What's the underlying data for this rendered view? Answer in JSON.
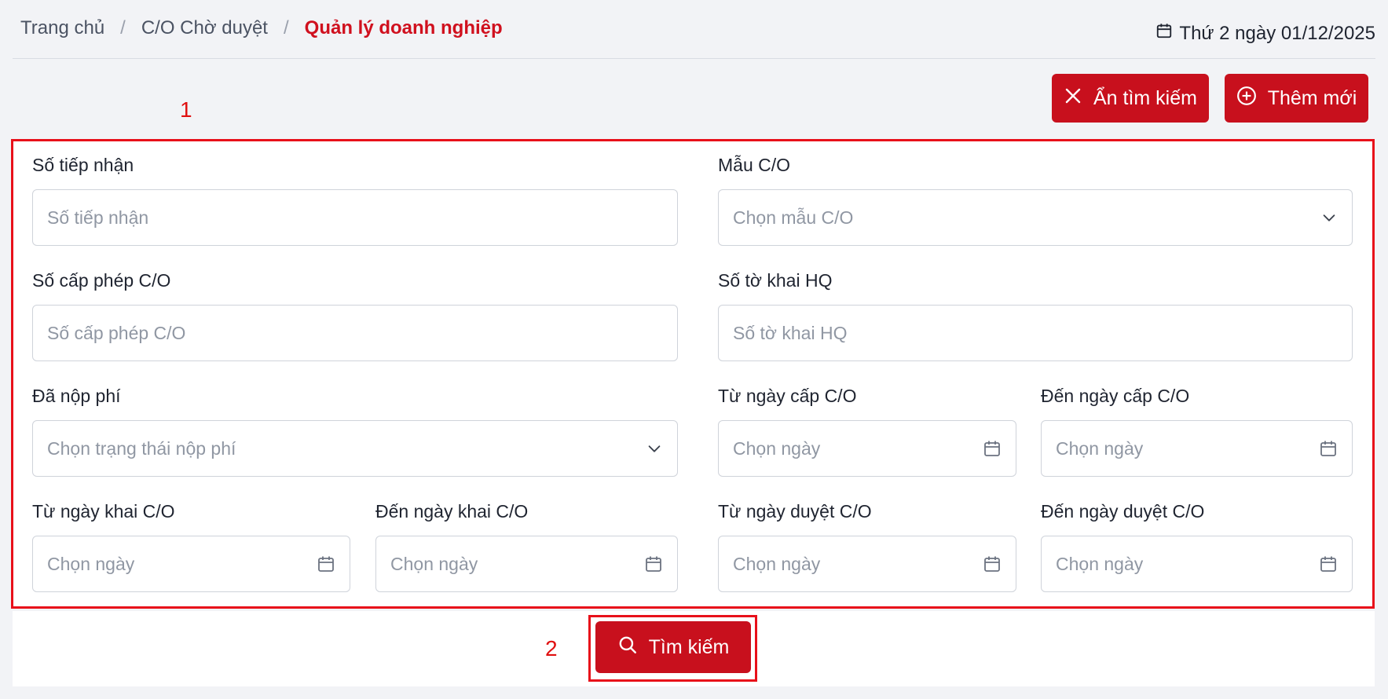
{
  "breadcrumb": {
    "home": "Trang chủ",
    "pending": "C/O Chờ duyệt",
    "current": "Quản lý doanh nghiệp",
    "separator": "/"
  },
  "date_text": "Thứ 2 ngày 01/12/2025",
  "actions": {
    "hide_search": "Ẩn tìm kiếm",
    "add_new": "Thêm mới"
  },
  "annotations": {
    "one": "1",
    "two": "2"
  },
  "form": {
    "receipt_no": {
      "label": "Số tiếp nhận",
      "placeholder": "Số tiếp nhận"
    },
    "co_form": {
      "label": "Mẫu C/O",
      "placeholder": "Chọn mẫu C/O"
    },
    "license_no": {
      "label": "Số cấp phép C/O",
      "placeholder": "Số cấp phép C/O"
    },
    "customs_decl": {
      "label": "Số tờ khai HQ",
      "placeholder": "Số tờ khai HQ"
    },
    "fee_paid": {
      "label": "Đã nộp phí",
      "placeholder": "Chọn trạng thái nộp phí"
    },
    "issue_from": {
      "label": "Từ ngày cấp C/O",
      "placeholder": "Chọn ngày"
    },
    "issue_to": {
      "label": "Đến ngày cấp C/O",
      "placeholder": "Chọn ngày"
    },
    "declare_from": {
      "label": "Từ ngày khai C/O",
      "placeholder": "Chọn ngày"
    },
    "declare_to": {
      "label": "Đến ngày khai C/O",
      "placeholder": "Chọn ngày"
    },
    "approve_from": {
      "label": "Từ ngày duyệt C/O",
      "placeholder": "Chọn ngày"
    },
    "approve_to": {
      "label": "Đến ngày duyệt C/O",
      "placeholder": "Chọn ngày"
    }
  },
  "search_button": "Tìm kiếm",
  "colors": {
    "accent": "#c8101d",
    "annotation": "#e8101a"
  }
}
